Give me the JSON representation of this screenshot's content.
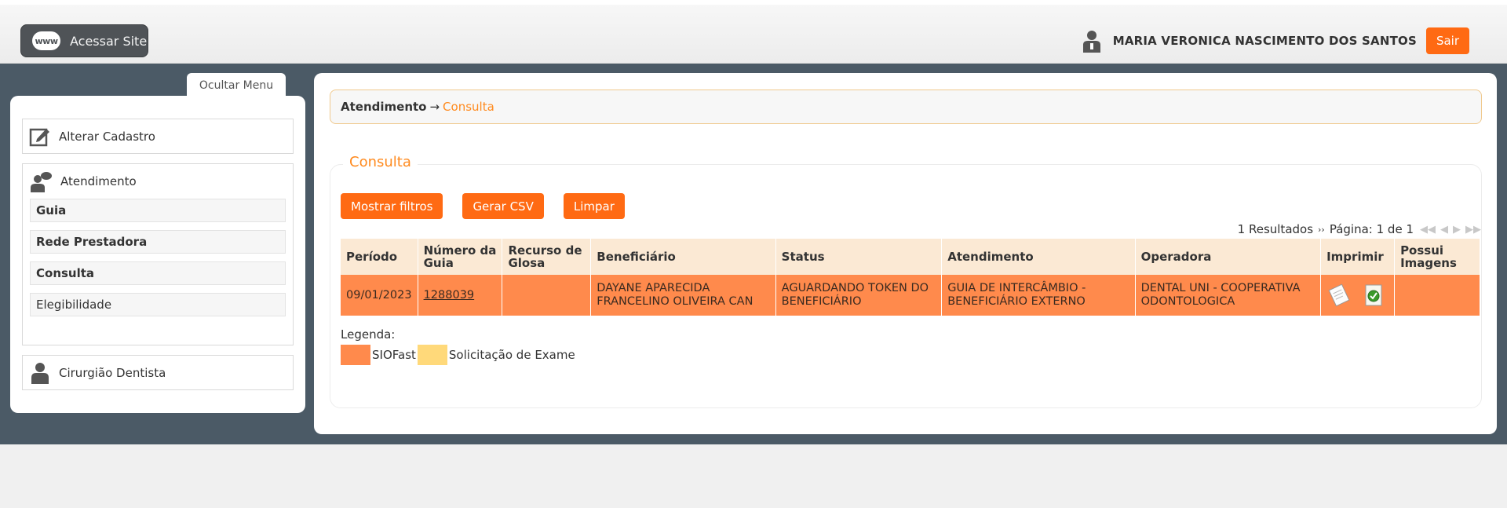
{
  "header": {
    "site_button_label": "Acessar Site",
    "site_icon_text": "www",
    "user_name": "MARIA VERONICA NASCIMENTO DOS SANTOS",
    "logout_label": "Sair"
  },
  "sidebar": {
    "toggle_label": "Ocultar Menu",
    "alterar_cadastro": "Alterar Cadastro",
    "atendimento": {
      "label": "Atendimento",
      "items": [
        {
          "label": "Guia"
        },
        {
          "label": "Rede Prestadora"
        },
        {
          "label": "Consulta"
        },
        {
          "label": "Elegibilidade"
        }
      ]
    },
    "cirurgiao": "Cirurgião Dentista"
  },
  "breadcrumb": {
    "root": "Atendimento",
    "arrow": "→",
    "current": "Consulta"
  },
  "panel": {
    "title": "Consulta",
    "buttons": {
      "filters": "Mostrar filtros",
      "csv": "Gerar CSV",
      "clear": "Limpar"
    },
    "pager": {
      "results": "1 Resultados",
      "page": "Página: 1 de 1"
    }
  },
  "table": {
    "columns": [
      "Período",
      "Número da Guia",
      "Recurso de Glosa",
      "Beneficiário",
      "Status",
      "Atendimento",
      "Operadora",
      "Imprimir",
      "Possui Imagens"
    ],
    "rows": [
      {
        "periodo": "09/01/2023",
        "numero": "1288039",
        "recurso": "",
        "beneficiario": "DAYANE APARECIDA FRANCELINO OLIVEIRA CAN",
        "status": "AGUARDANDO TOKEN DO BENEFICIÁRIO",
        "atendimento": "GUIA DE INTERCÂMBIO - BENEFICIÁRIO EXTERNO",
        "operadora": "DENTAL UNI - COOPERATIVA ODONTOLOGICA",
        "possui_imagens": ""
      }
    ]
  },
  "legend": {
    "title": "Legenda:",
    "items": [
      {
        "label": "SIOFast",
        "color": "#ff8a4c"
      },
      {
        "label": "Solicitação de Exame",
        "color": "#ffd97a"
      }
    ]
  },
  "colors": {
    "accent": "#ff6a13",
    "band": "#4b5a66",
    "row_highlight": "#ff8a4c"
  }
}
